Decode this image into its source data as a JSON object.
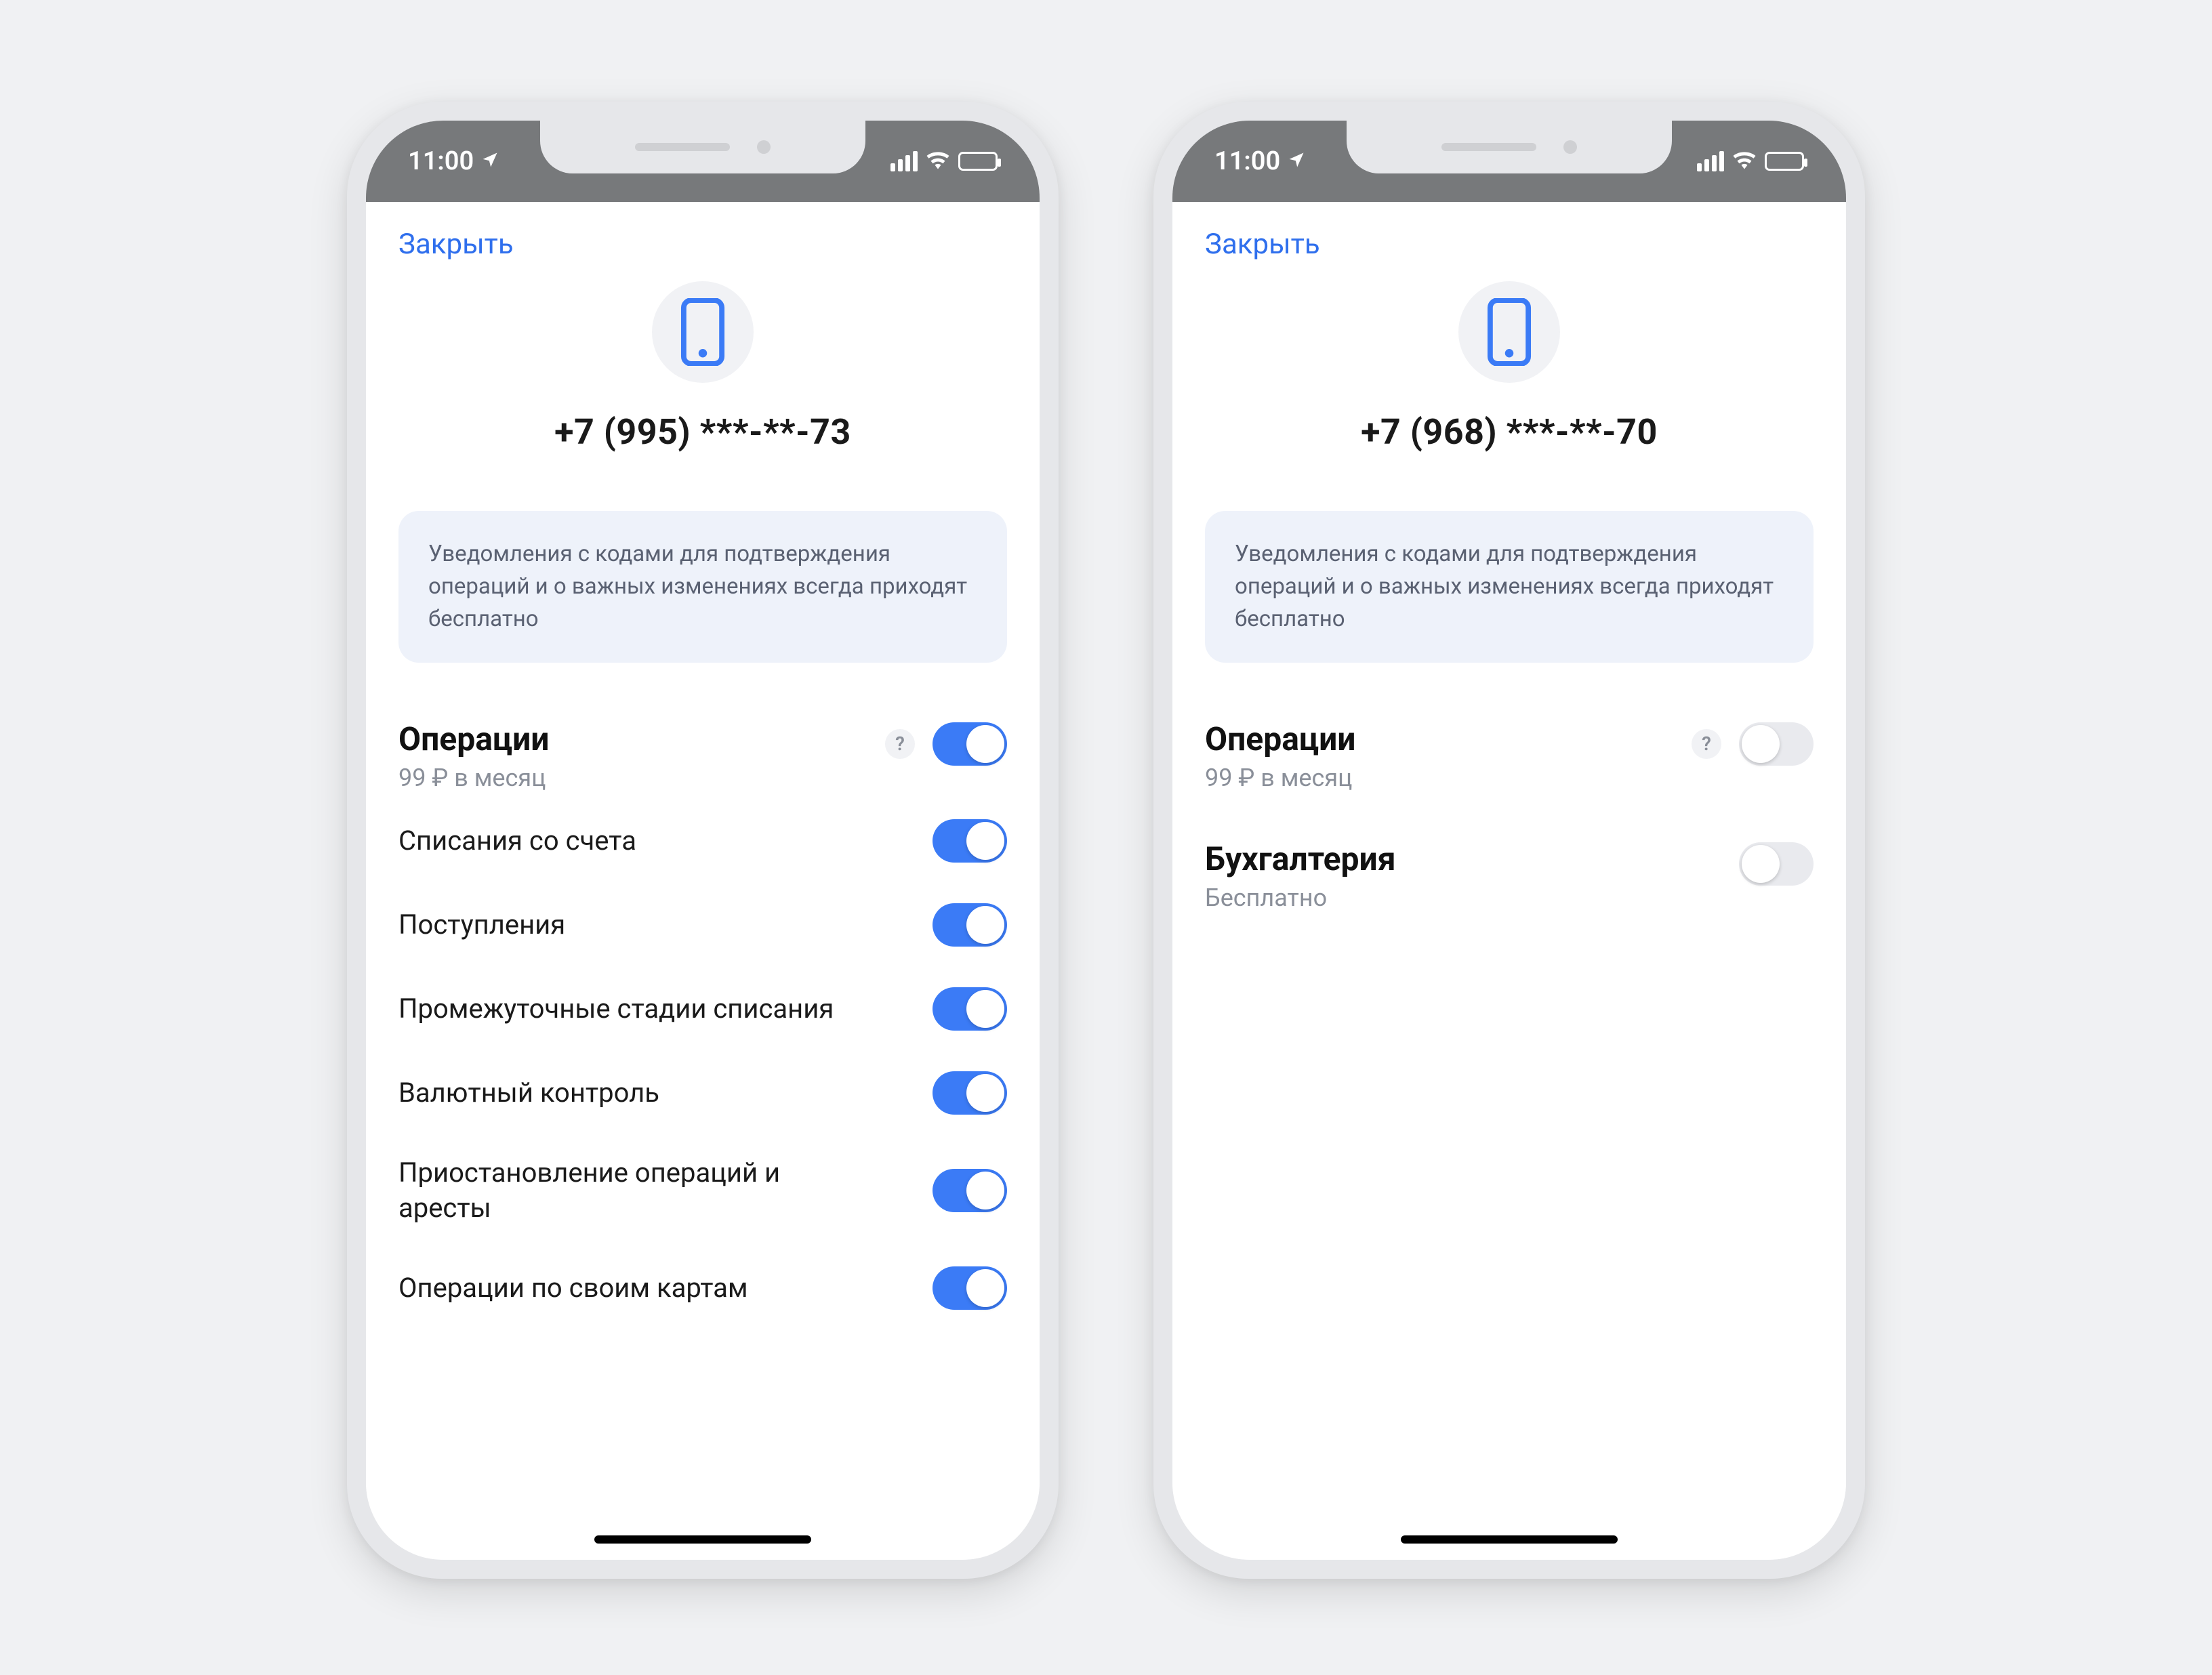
{
  "status": {
    "time": "11:00"
  },
  "screens": [
    {
      "close_label": "Закрыть",
      "phone_number": "+7 (995) ***-**-73",
      "info_text": "Уведомления с кодами для подтверждения операций и о важных изменениях всегда приходят бесплатно",
      "sections": [
        {
          "title": "Операции",
          "subtitle": "99 ₽ в месяц",
          "help": "?",
          "toggle_on": true,
          "items": [
            {
              "label": "Списания со счета",
              "on": true
            },
            {
              "label": "Поступления",
              "on": true
            },
            {
              "label": "Промежуточные стадии списания",
              "on": true
            },
            {
              "label": "Валютный контроль",
              "on": true
            },
            {
              "label": "Приостановление операций и аресты",
              "on": true
            },
            {
              "label": "Операции по своим картам",
              "on": true
            }
          ]
        }
      ]
    },
    {
      "close_label": "Закрыть",
      "phone_number": "+7 (968) ***-**-70",
      "info_text": "Уведомления с кодами для подтверждения операций и о важных изменениях всегда приходят бесплатно",
      "sections": [
        {
          "title": "Операции",
          "subtitle": "99 ₽ в месяц",
          "help": "?",
          "toggle_on": false,
          "items": []
        },
        {
          "title": "Бухгалтерия",
          "subtitle": "Бесплатно",
          "help": null,
          "toggle_on": false,
          "items": []
        }
      ]
    }
  ]
}
